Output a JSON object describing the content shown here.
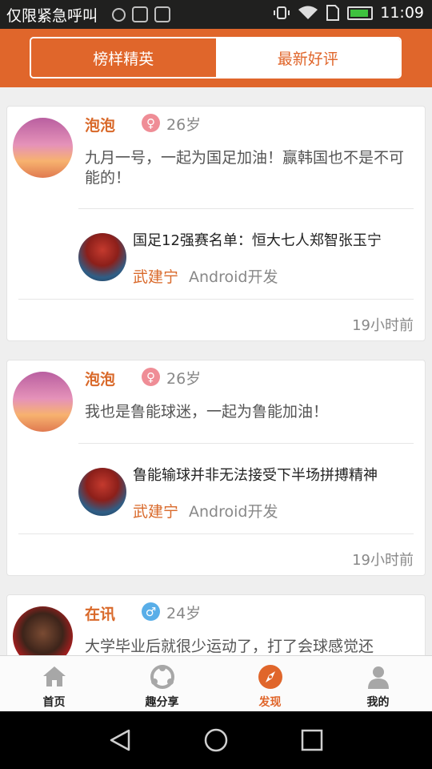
{
  "status_bar": {
    "carrier_text": "仅限紧急呼叫",
    "time": "11:09"
  },
  "header": {
    "tabs": [
      {
        "label": "榜样精英",
        "active": true
      },
      {
        "label": "最新好评",
        "active": false
      }
    ]
  },
  "feed": [
    {
      "user": "泡泡",
      "gender": "female",
      "gender_symbol": "♀",
      "age": "26岁",
      "comment": "九月一号，一起为国足加油！赢韩国也不是不可能的！",
      "article_title": "国足12强赛名单：恒大七人郑智张玉宁",
      "author": "武建宁",
      "author_role": "Android开发",
      "time": "19小时前"
    },
    {
      "user": "泡泡",
      "gender": "female",
      "gender_symbol": "♀",
      "age": "26岁",
      "comment": "我也是鲁能球迷，一起为鲁能加油！",
      "article_title": "鲁能输球并非无法接受下半场拼搏精神",
      "author": "武建宁",
      "author_role": "Android开发",
      "time": "19小时前"
    },
    {
      "user": "在讯",
      "gender": "male",
      "gender_symbol": "♂",
      "age": "24岁",
      "comment": "大学毕业后就很少运动了，打了会球感觉还"
    }
  ],
  "tabbar": {
    "tabs": [
      {
        "label": "首页",
        "icon": "home-icon"
      },
      {
        "label": "趣分享",
        "icon": "share-icon"
      },
      {
        "label": "发现",
        "icon": "compass-icon",
        "active": true
      },
      {
        "label": "我的",
        "icon": "person-icon"
      }
    ]
  },
  "colors": {
    "accent": "#e0662b",
    "female": "#ef8d96",
    "male": "#59aee8"
  }
}
